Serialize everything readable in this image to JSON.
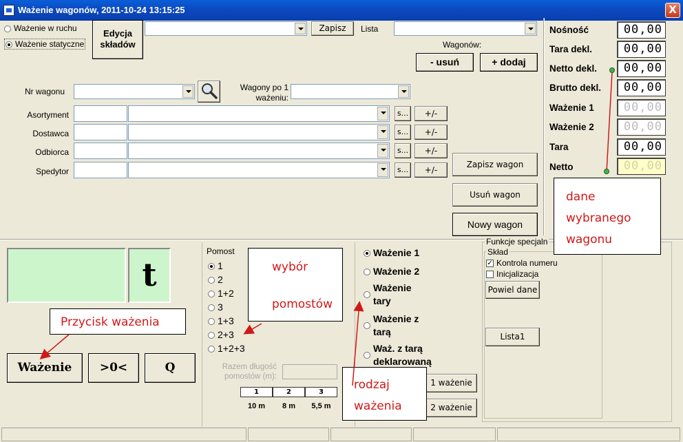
{
  "window": {
    "title": "Ważenie wagonów,  2011-10-24 13:15:25",
    "close": "X"
  },
  "mode": {
    "options": [
      "Ważenie w ruchu",
      "Ważenie statyczne"
    ],
    "selected": 1
  },
  "edit_button": "Edycja\nskładów",
  "save_btn": "Zapisz",
  "lista_label": "Lista",
  "wagons_label": "Wagonów:",
  "remove_btn": "- usuń",
  "add_btn": "+ dodaj",
  "nr_wagonu_label": "Nr wagonu",
  "wagony_po_label": "Wagony po 1\nważeniu:",
  "rows": [
    {
      "label": "Asortyment"
    },
    {
      "label": "Dostawca"
    },
    {
      "label": "Odbiorca"
    },
    {
      "label": "Spedytor"
    }
  ],
  "s_btn": "s...",
  "pm_btn": "+/-",
  "zapisz_wagon": "Zapisz wagon",
  "usun_wagon": "Usuń wagon",
  "nowy_wagon": "Nowy wagon",
  "values": [
    {
      "label": "Nośność",
      "value": "00,00",
      "style": "normal"
    },
    {
      "label": "Tara dekl.",
      "value": "00,00",
      "style": "normal"
    },
    {
      "label": "Netto dekl.",
      "value": "00,00",
      "style": "normal"
    },
    {
      "label": "Brutto dekl.",
      "value": "00,00",
      "style": "normal"
    },
    {
      "label": "Ważenie 1",
      "value": "00,00",
      "style": "grey"
    },
    {
      "label": "Ważenie 2",
      "value": "00,00",
      "style": "grey"
    },
    {
      "label": "Tara",
      "value": "00,00",
      "style": "normal"
    },
    {
      "label": "Netto",
      "value": "00,00",
      "style": "yellow"
    }
  ],
  "unit": "t",
  "buttons_bottom": {
    "weigh": "Ważenie",
    "zero": ">0<",
    "q": "Q"
  },
  "pomost": {
    "label": "Pomost",
    "options": [
      "1",
      "2",
      "1+2",
      "3",
      "1+3",
      "2+3",
      "1+2+3"
    ],
    "selected": 0,
    "razem_label": "Razem długość\npomostów (m):",
    "segments": [
      "1",
      "2",
      "3"
    ],
    "lengths": [
      "10 m",
      "8 m",
      "5,5 m"
    ]
  },
  "weighing_type": {
    "options": [
      "Ważenie 1",
      "Ważenie 2",
      "Ważenie\ntary",
      "Ważenie z\ntarą",
      "Waż. z tarą\ndeklarowaną"
    ],
    "selected": 0
  },
  "one_weigh": "1 ważenie",
  "two_weigh": "2 ważenie",
  "funkcje": {
    "label": "Funkcje specjaln",
    "sklad_label": "Skład",
    "kontrola": "Kontrola numeru",
    "kontrola_checked": true,
    "inicjalizacja": "Inicjalizacja",
    "powiel": "Powiel dane",
    "lista1": "Lista1"
  },
  "annotations": {
    "dane": "dane\nwybranego\nwagonu",
    "wybor": "wybór\n\npomostów",
    "przycisk": "Przycisk ważenia",
    "rodzaj": "rodzaj\nważenia"
  },
  "colors": {
    "annotation_text": "#d01818",
    "display_green": "#ccf5cc",
    "netto_yellow": "#ffffc9"
  }
}
